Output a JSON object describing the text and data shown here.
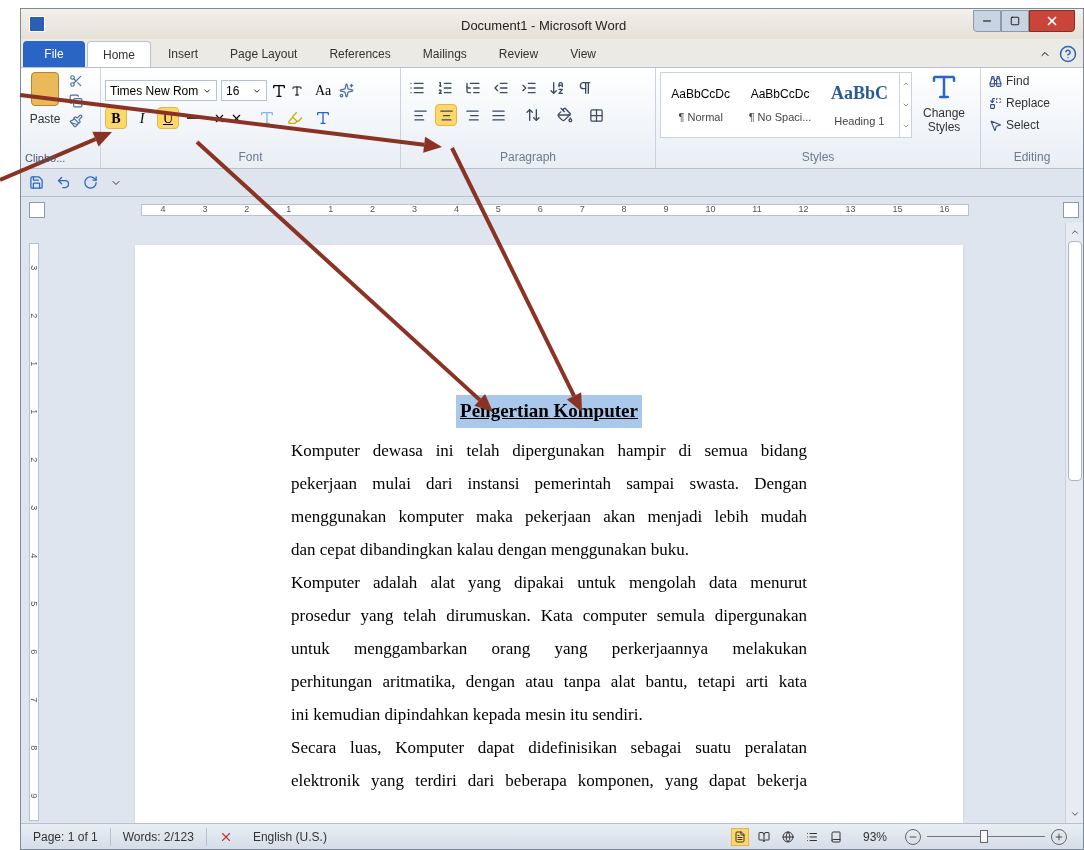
{
  "window": {
    "title": "Document1 - Microsoft Word"
  },
  "tabs": [
    {
      "label": "File",
      "kind": "file",
      "selected": false
    },
    {
      "label": "Home",
      "kind": "tab",
      "selected": true
    },
    {
      "label": "Insert",
      "kind": "tab",
      "selected": false
    },
    {
      "label": "Page Layout",
      "kind": "tab",
      "selected": false
    },
    {
      "label": "References",
      "kind": "tab",
      "selected": false
    },
    {
      "label": "Mailings",
      "kind": "tab",
      "selected": false
    },
    {
      "label": "Review",
      "kind": "tab",
      "selected": false
    },
    {
      "label": "View",
      "kind": "tab",
      "selected": false
    }
  ],
  "clipboard": {
    "paste": "Paste",
    "group_label": "Clipbo..."
  },
  "font": {
    "name": "Times New Rom",
    "size": "16",
    "case_button": "Aa",
    "bold": {
      "label": "B",
      "on": true
    },
    "italic": {
      "label": "I",
      "on": false
    },
    "underline": {
      "label": "U",
      "on": true
    },
    "group_label": "Font"
  },
  "paragraph": {
    "alignments": [
      {
        "kind": "left",
        "selected": false
      },
      {
        "kind": "center",
        "selected": true
      },
      {
        "kind": "right",
        "selected": false
      },
      {
        "kind": "justify",
        "selected": false
      }
    ],
    "group_label": "Paragraph"
  },
  "styles": {
    "items": [
      {
        "preview": "AaBbCcDc",
        "name": "¶ Normal",
        "kind": "normal"
      },
      {
        "preview": "AaBbCcDc",
        "name": "¶ No Spaci...",
        "kind": "normal"
      },
      {
        "preview": "AaBbC",
        "name": "Heading 1",
        "kind": "heading"
      }
    ],
    "change_styles": [
      "Change",
      "Styles"
    ],
    "group_label": "Styles"
  },
  "editing": {
    "items": [
      {
        "label": "Find",
        "kind": "find"
      },
      {
        "label": "Replace",
        "kind": "replace"
      },
      {
        "label": "Select",
        "kind": "select"
      }
    ],
    "group_label": "Editing"
  },
  "ruler_numbers": [
    "4",
    "3",
    "2",
    "1",
    "1",
    "2",
    "3",
    "4",
    "5",
    "6",
    "7",
    "8",
    "9",
    "10",
    "11",
    "12",
    "13",
    "15",
    "16"
  ],
  "vertical_ruler_numbers": [
    "3",
    "2",
    "1",
    "1",
    "2",
    "3",
    "4",
    "5",
    "6",
    "7",
    "8",
    "9"
  ],
  "document": {
    "heading": "Pengertian Komputer",
    "heading_selected": true,
    "paragraphs": [
      [
        "Komputer dewasa ini telah dipergunakan hampir di semua bidang",
        "pekerjaan mulai dari instansi pemerintah sampai swasta. Dengan",
        "menggunakan komputer maka pekerjaan akan menjadi lebih mudah",
        "dan cepat dibandingkan kalau dengan menggunakan buku."
      ],
      [
        "Komputer adalah alat yang dipakai untuk mengolah data menurut",
        "prosedur yang telah dirumuskan. Kata computer semula dipergunakan",
        "untuk menggambarkan orang yang perkerjaannya melakukan",
        "perhitungan aritmatika, dengan atau tanpa alat bantu, tetapi arti kata",
        "ini kemudian dipindahkan kepada mesin itu sendiri."
      ],
      [
        "Secara luas, Komputer dapat didefinisikan sebagai suatu peralatan",
        "elektronik yang terdiri dari beberapa komponen, yang dapat bekerja"
      ]
    ]
  },
  "status_bar": {
    "page": "Page: 1 of 1",
    "words": "Words: 2/123",
    "language": "English (U.S.)",
    "views": [
      {
        "selected": true
      },
      {
        "selected": false
      },
      {
        "selected": false
      },
      {
        "selected": false
      },
      {
        "selected": false
      }
    ],
    "zoom": "93%",
    "zoom_level": {
      "level": 0.48
    }
  }
}
